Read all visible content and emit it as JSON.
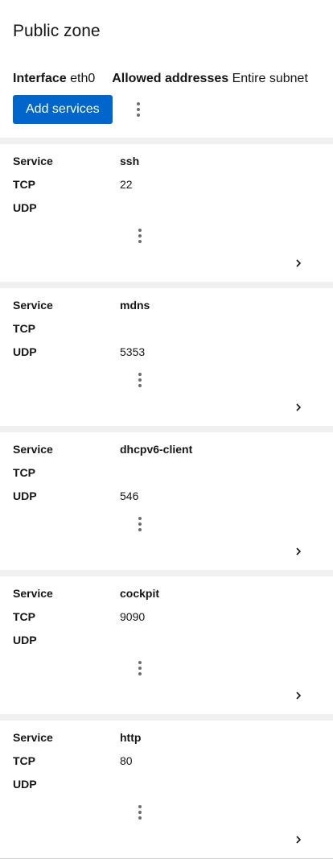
{
  "zone": {
    "title": "Public zone",
    "interface_label": "Interface",
    "interface_value": "eth0",
    "allowed_label": "Allowed addresses",
    "allowed_value": "Entire subnet"
  },
  "toolbar": {
    "add_services_label": "Add services",
    "actions_icon": "kebab-icon"
  },
  "labels": {
    "service": "Service",
    "tcp": "TCP",
    "udp": "UDP"
  },
  "services": [
    {
      "name": "ssh",
      "tcp": "22",
      "udp": ""
    },
    {
      "name": "mdns",
      "tcp": "",
      "udp": "5353"
    },
    {
      "name": "dhcpv6-client",
      "tcp": "",
      "udp": "546"
    },
    {
      "name": "cockpit",
      "tcp": "9090",
      "udp": ""
    },
    {
      "name": "http",
      "tcp": "80",
      "udp": ""
    }
  ],
  "colors": {
    "primary": "#0066cc",
    "separator": "#f0f0f0",
    "icon": "#6a6e73"
  }
}
